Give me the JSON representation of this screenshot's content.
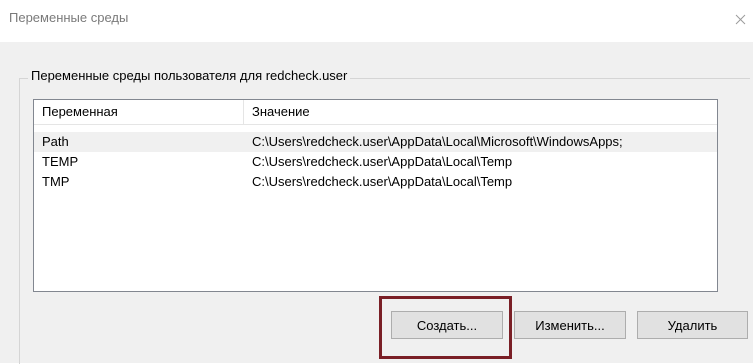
{
  "window": {
    "title": "Переменные среды",
    "close_icon": "close-icon"
  },
  "user_group": {
    "legend": "Переменные среды пользователя для redcheck.user",
    "columns": [
      "Переменная",
      "Значение"
    ],
    "rows": [
      {
        "name": "Path",
        "value": "C:\\Users\\redcheck.user\\AppData\\Local\\Microsoft\\WindowsApps;",
        "selected": true
      },
      {
        "name": "TEMP",
        "value": "C:\\Users\\redcheck.user\\AppData\\Local\\Temp",
        "selected": false
      },
      {
        "name": "TMP",
        "value": "C:\\Users\\redcheck.user\\AppData\\Local\\Temp",
        "selected": false
      }
    ],
    "buttons": {
      "create_label": "Создать...",
      "edit_label": "Изменить...",
      "delete_label": "Удалить"
    }
  },
  "colors": {
    "highlight_frame": "#7a1f26",
    "selected_row": "#f0f0f0",
    "dialog_bg": "#f0f0f0"
  }
}
